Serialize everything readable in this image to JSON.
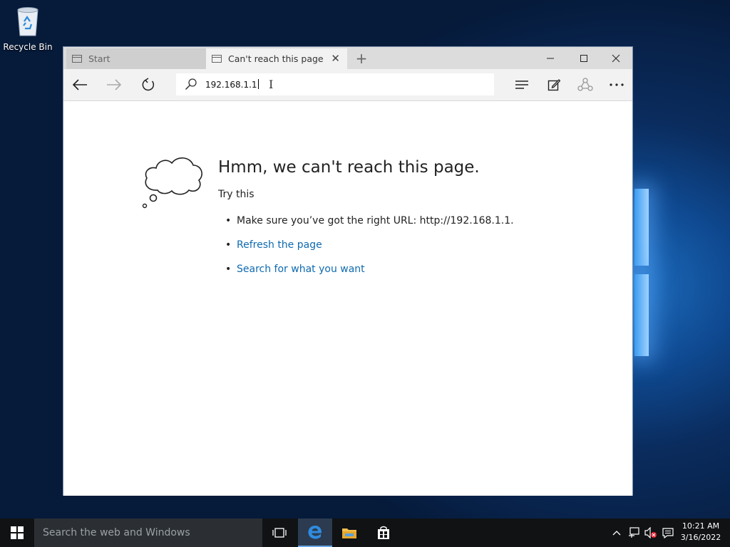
{
  "desktop": {
    "recycle_bin_label": "Recycle Bin"
  },
  "browser": {
    "tabs": [
      {
        "label": "Start",
        "active": false
      },
      {
        "label": "Can't reach this page",
        "active": true
      }
    ],
    "address_value": "192.168.1.1"
  },
  "error_page": {
    "headline": "Hmm, we can't reach this page.",
    "try_this": "Try this",
    "suggestion_url": "Make sure you’ve got the right URL: http://192.168.1.1.",
    "refresh_link": "Refresh the page",
    "search_link": "Search for what you want"
  },
  "taskbar": {
    "search_placeholder": "Search the web and Windows",
    "clock_time": "10:21 AM",
    "clock_date": "3/16/2022"
  },
  "colors": {
    "link": "#0f6ab0",
    "taskbar": "#101214",
    "desktop": "#0a2c5e"
  }
}
